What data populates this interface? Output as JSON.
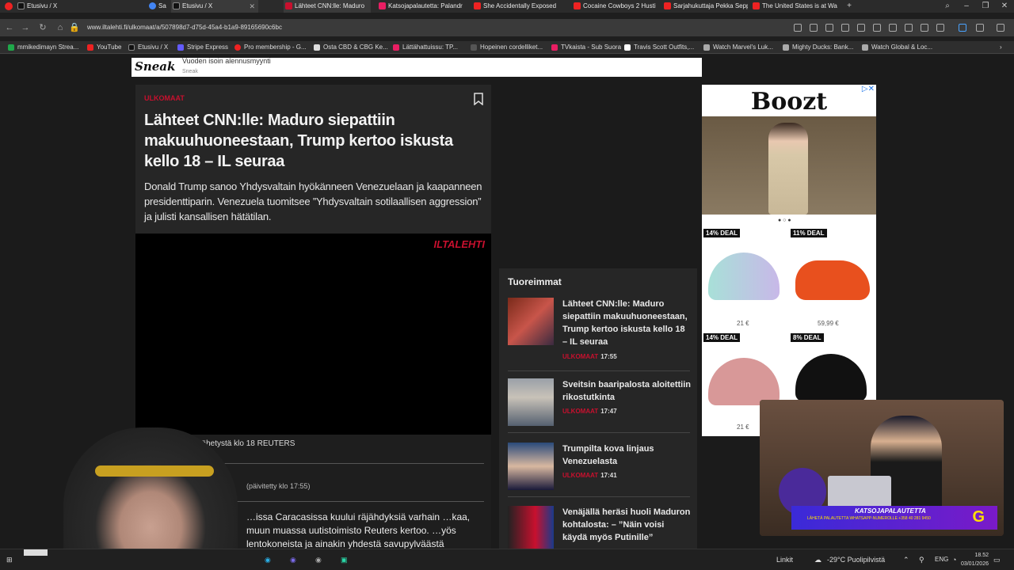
{
  "tabs": [
    {
      "title": "Etusivu / X",
      "color": "#e22"
    },
    {
      "title": "Sa",
      "color": "#4285f4"
    },
    {
      "title": "Etusivu / X",
      "color": "#fff"
    },
    {
      "title": "Lähteet CNN:lle: Maduro",
      "color": "#c8102e"
    },
    {
      "title": "Katsojapalautetta: Palandr",
      "color": "#e91e63"
    },
    {
      "title": "She Accidentally Exposed",
      "color": "#e22"
    },
    {
      "title": "Cocaine Cowboys 2 Husti",
      "color": "#e22"
    },
    {
      "title": "Sarjahukuttaja Pekka Sepp",
      "color": "#e22"
    },
    {
      "title": "The United States is at Wa",
      "color": "#e22"
    }
  ],
  "new_tab": "+",
  "url": "www.iltalehti.fi/ulkomaat/a/507898d7-d75d-45a4-b1a9-89165690c6bc",
  "bookmarks": [
    {
      "label": "mmikedimayn Strea...",
      "color": "#1fa84a"
    },
    {
      "label": "YouTube",
      "color": "#e22"
    },
    {
      "label": "Etusivu / X",
      "color": "#fff"
    },
    {
      "label": "Stripe Express",
      "color": "#635bff"
    },
    {
      "label": "Pro membership - G...",
      "color": "#e22"
    },
    {
      "label": "Osta CBD & CBG Ke...",
      "color": "#ddd"
    },
    {
      "label": "Lättähattuissu: TP...",
      "color": "#e91e63"
    },
    {
      "label": "Hopeinen cordelliket...",
      "color": "#333"
    },
    {
      "label": "TVkaista - Sub Suora",
      "color": "#e91e63"
    },
    {
      "label": "Travis Scott Outfits,...",
      "color": "#fff"
    },
    {
      "label": "Watch Marvel's Luk...",
      "color": "#aaa"
    },
    {
      "label": "Mighty Ducks: Bank...",
      "color": "#aaa"
    },
    {
      "label": "Watch Global & Loc...",
      "color": "#aaa"
    }
  ],
  "banner": {
    "logo": "Sneak",
    "text": "Vuoden isoin alennusmyynti",
    "sub": "Sneak"
  },
  "article": {
    "category": "ULKOMAAT",
    "headline": "Lähteet CNN:lle: Maduro siepattiin makuuhuoneestaan, Trump kertoo iskusta kello 18 – IL seuraa",
    "lead": "Donald Trump sanoo Yhdysvaltain hyökänneen Venezuelaan ja kaapanneen presidenttiparin. Venezuela tuomitsee ”Yhdysvaltain sotilaallisen aggression” ja julisti kansallisen hätätilan.",
    "video_logo": "ILTALEHTI",
    "caption": "Lähetystä klo 18 REUTERS",
    "updated": "(päivitetty klo 17:55)",
    "body": "…issa Caracasissa kuului räjähdyksiä varhain …kaa, muun muassa uutistoimisto Reuters kertoo. …yös lentokoneista ja ainakin yhdestä savupylväästä"
  },
  "latest": {
    "title": "Tuoreimmat",
    "items": [
      {
        "title": "Lähteet CNN:lle: Maduro siepattiin makuuhuoneestaan, Trump kertoo iskusta kello 18 – IL seuraa",
        "category": "ULKOMAAT",
        "time": "17:55"
      },
      {
        "title": "Sveitsin baaripalosta aloitettiin rikostutkinta",
        "category": "ULKOMAAT",
        "time": "17:47"
      },
      {
        "title": "Trumpilta kova linjaus Venezuelasta",
        "category": "ULKOMAAT",
        "time": "17:41"
      },
      {
        "title": "Venäjällä heräsi huoli Maduron kohtalosta: – ”Näin voisi käydä myös Putinille”",
        "category": "",
        "time": ""
      }
    ]
  },
  "ad": {
    "brand": "Boozt",
    "deals": [
      "14% DEAL",
      "11% DEAL",
      "14% DEAL",
      "8% DEAL"
    ],
    "prices": [
      "21 €",
      "59,99 €",
      "21 €"
    ]
  },
  "stream_overlay": {
    "title": "KATSOJAPALAUTETTA",
    "sub": "LÄHETÄ PALAUTETTA WHATSAPP-NUMEROLLE +358 40 281 9450"
  },
  "taskbar": {
    "links": "Linkit",
    "weather": "-29°C Puolipilvistä",
    "lang": "ENG",
    "time": "18.52",
    "date": "03/01/2026"
  },
  "colors": {
    "accent": "#c8102e",
    "page_bg": "#1b1b1b",
    "card_bg": "#262626"
  }
}
